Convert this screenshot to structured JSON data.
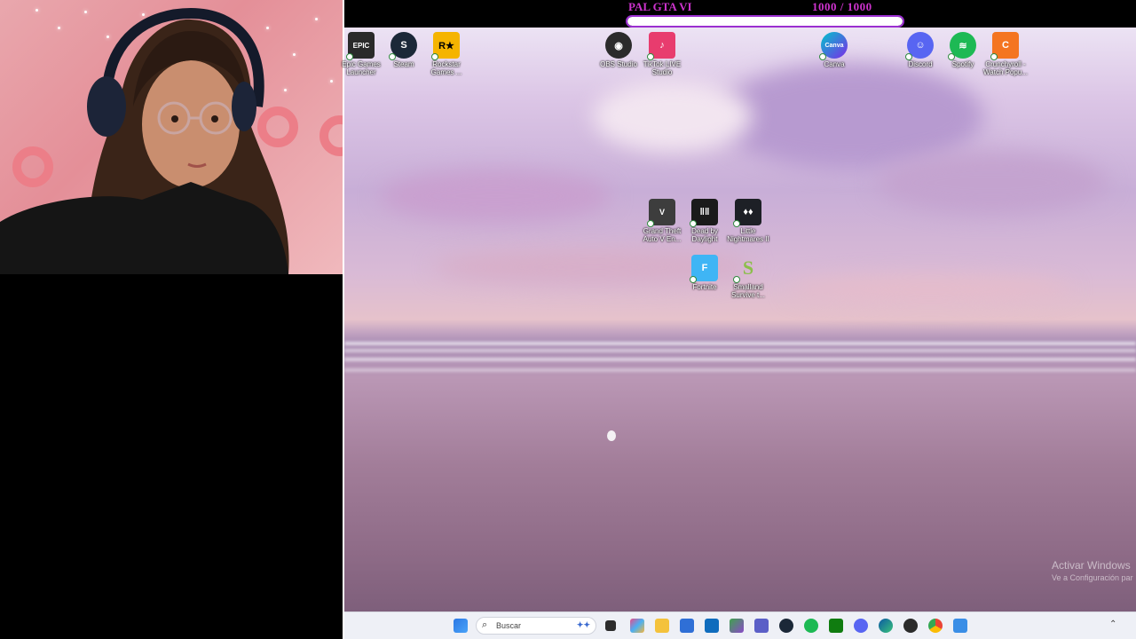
{
  "stream_goal": {
    "title": "PAL GTA VI",
    "count": "1000  / 1000",
    "progress": 1.0,
    "color": "#cc33cc"
  },
  "desktop_icons": {
    "epic": "Epic Games Launcher",
    "steam": "Steam",
    "rockstar": "Rockstar Games ...",
    "obs": "OBS Studio",
    "tiktok": "TikTok LIVE Studio",
    "canva": "Canva",
    "discord": "Discord",
    "spotify": "Spotify",
    "crunchyroll": "Crunchyroll - Watch Popu...",
    "gta": "Grand Theft Auto V En...",
    "dbd": "Dead by Daylight",
    "nightmares": "Little Nightmares II",
    "fortnite": "Fortnite",
    "smalland": "Smalland Survive t..."
  },
  "watermark": {
    "line1": "Activar Windows",
    "line2": "Ve a Configuración par"
  },
  "taskbar": {
    "search_placeholder": "Buscar"
  }
}
